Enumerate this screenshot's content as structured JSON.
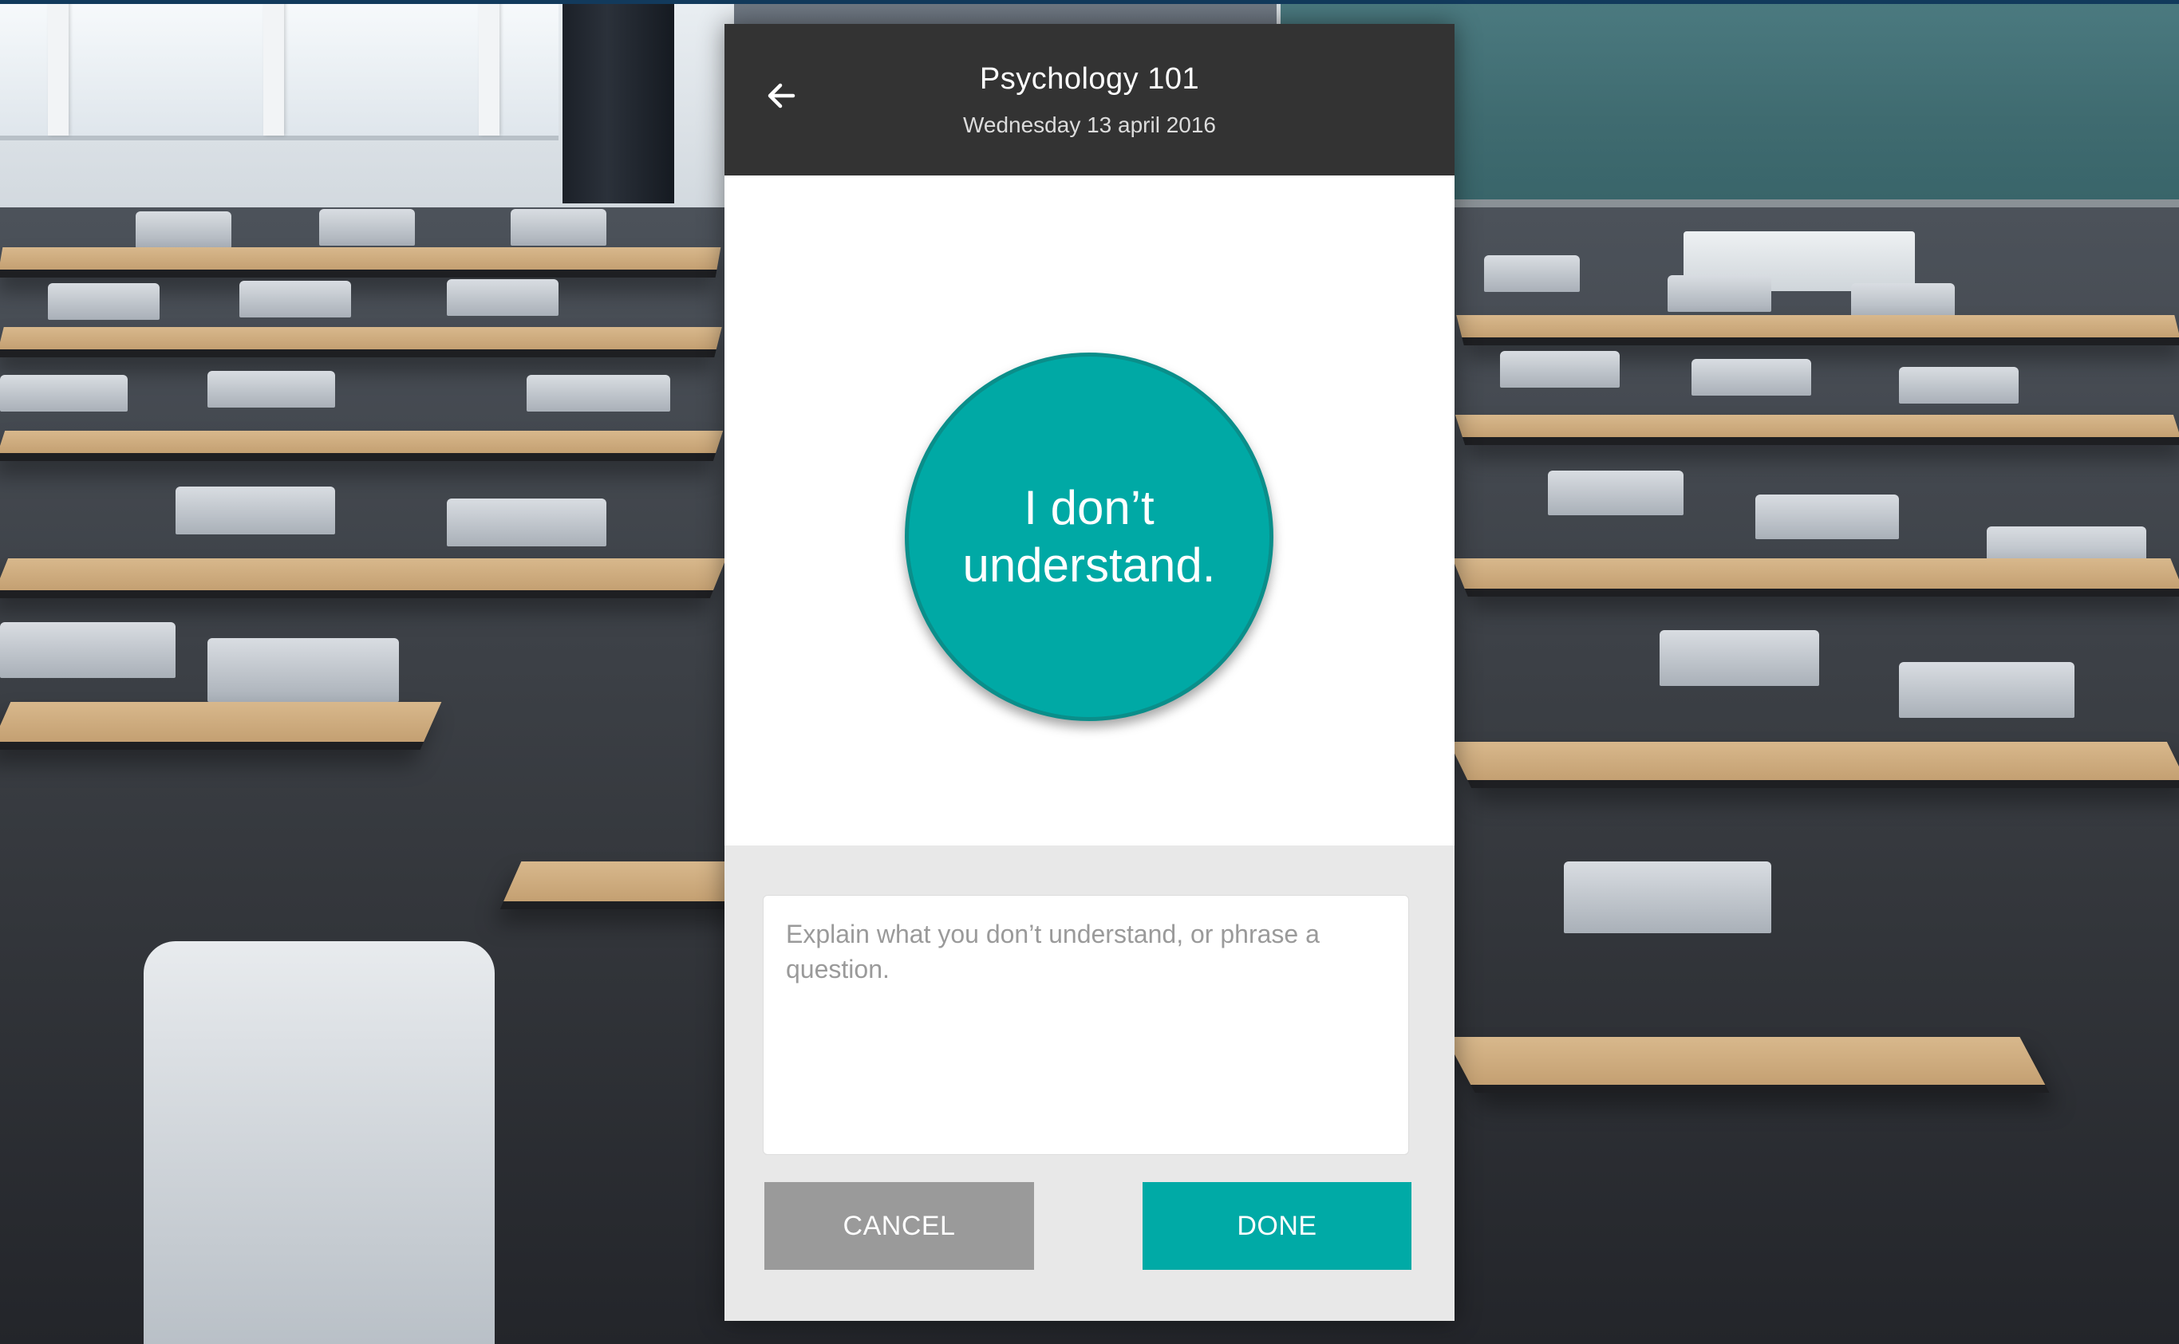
{
  "header": {
    "back_icon": "arrow-left-icon",
    "title": "Psychology 101",
    "date": "Wednesday 13 april 2016"
  },
  "reaction": {
    "label": "I don’t understand.",
    "color": "#00a9a5"
  },
  "question": {
    "value": "",
    "placeholder": "Explain what you don’t understand, or phrase a question."
  },
  "actions": {
    "cancel_label": "CANCEL",
    "done_label": "DONE",
    "cancel_color": "#9a9a9a",
    "done_color": "#00aaa6"
  },
  "colors": {
    "header_bg": "#333333",
    "panel_bg": "#e8e8e8"
  }
}
